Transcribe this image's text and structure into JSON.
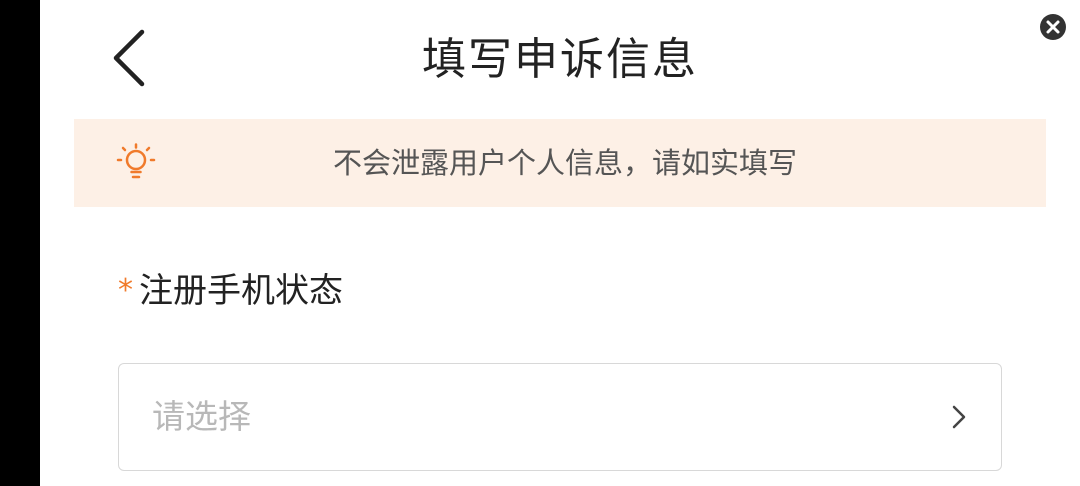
{
  "header": {
    "title": "填写申诉信息",
    "back_icon": "chevron-left-icon",
    "close_icon": "close-circle-icon"
  },
  "notice": {
    "icon": "lightbulb-icon",
    "text": "不会泄露用户个人信息，请如实填写",
    "background_color": "#fdf0e6",
    "icon_color": "#f07a2b"
  },
  "form": {
    "field": {
      "required_mark": "*",
      "label": "注册手机状态",
      "placeholder": "请选择",
      "chevron_icon": "chevron-right-icon"
    }
  },
  "colors": {
    "accent": "#f07a2b",
    "text_primary": "#222222",
    "placeholder": "#b8b8b8"
  }
}
